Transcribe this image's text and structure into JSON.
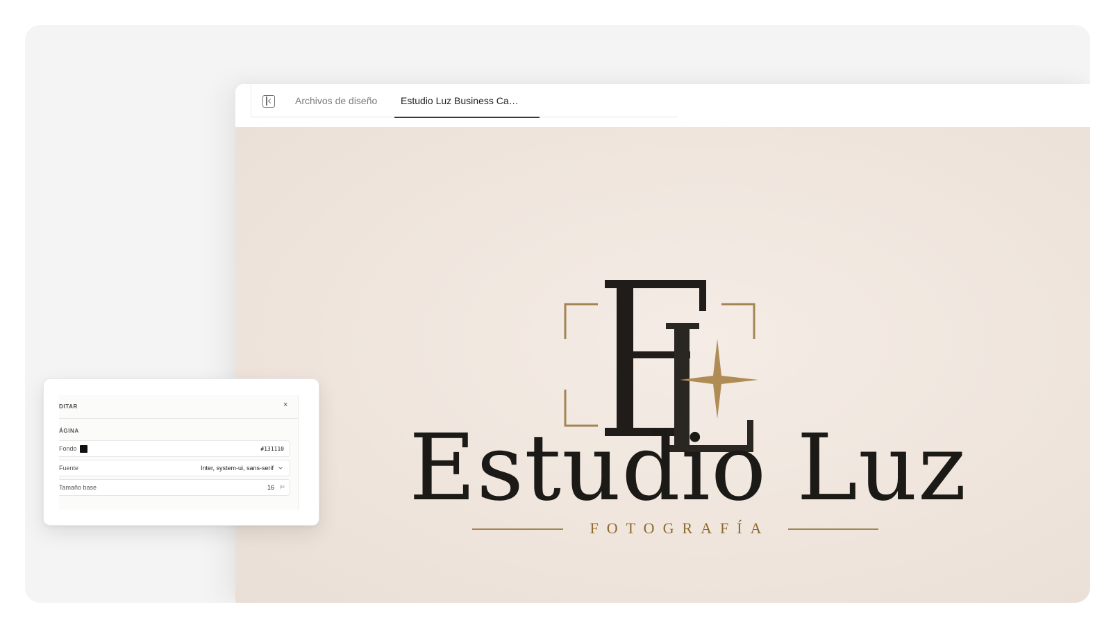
{
  "tabs": {
    "sidebar_toggle": "sidebar-toggle-icon",
    "items": [
      {
        "label": "Archivos de diseño",
        "active": false
      },
      {
        "label": "Estudio Luz Business Ca…",
        "active": true
      }
    ]
  },
  "canvas": {
    "monogram": "EL",
    "wordmark": "Estudio Luz",
    "tagline": "FOTOGRAFÍA",
    "colors": {
      "background": "#efe5dd",
      "ink": "#1c1a17",
      "gold": "#a48452"
    }
  },
  "edit_panel": {
    "title": "DITAR",
    "close_glyph": "×",
    "section": "ÁGINA",
    "fields": {
      "background": {
        "label": "Fondo",
        "value": "#131110",
        "swatch_color": "#131110"
      },
      "font": {
        "label": "Fuente",
        "value": "Inter, system-ui, sans-serif"
      },
      "base_size": {
        "label": "Tamaño base",
        "value": "16",
        "unit": "px"
      }
    }
  }
}
